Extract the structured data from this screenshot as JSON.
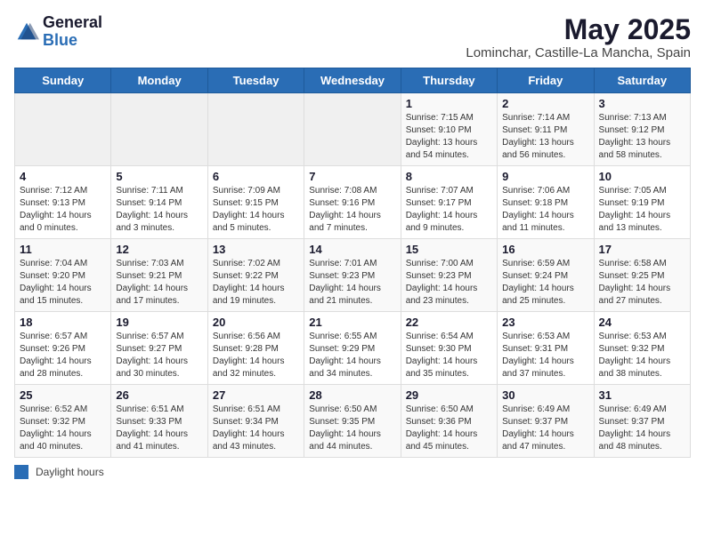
{
  "header": {
    "logo_general": "General",
    "logo_blue": "Blue",
    "month_title": "May 2025",
    "location": "Lominchar, Castille-La Mancha, Spain"
  },
  "weekdays": [
    "Sunday",
    "Monday",
    "Tuesday",
    "Wednesday",
    "Thursday",
    "Friday",
    "Saturday"
  ],
  "weeks": [
    [
      {
        "day": "",
        "info": ""
      },
      {
        "day": "",
        "info": ""
      },
      {
        "day": "",
        "info": ""
      },
      {
        "day": "",
        "info": ""
      },
      {
        "day": "1",
        "info": "Sunrise: 7:15 AM\nSunset: 9:10 PM\nDaylight: 13 hours\nand 54 minutes."
      },
      {
        "day": "2",
        "info": "Sunrise: 7:14 AM\nSunset: 9:11 PM\nDaylight: 13 hours\nand 56 minutes."
      },
      {
        "day": "3",
        "info": "Sunrise: 7:13 AM\nSunset: 9:12 PM\nDaylight: 13 hours\nand 58 minutes."
      }
    ],
    [
      {
        "day": "4",
        "info": "Sunrise: 7:12 AM\nSunset: 9:13 PM\nDaylight: 14 hours\nand 0 minutes."
      },
      {
        "day": "5",
        "info": "Sunrise: 7:11 AM\nSunset: 9:14 PM\nDaylight: 14 hours\nand 3 minutes."
      },
      {
        "day": "6",
        "info": "Sunrise: 7:09 AM\nSunset: 9:15 PM\nDaylight: 14 hours\nand 5 minutes."
      },
      {
        "day": "7",
        "info": "Sunrise: 7:08 AM\nSunset: 9:16 PM\nDaylight: 14 hours\nand 7 minutes."
      },
      {
        "day": "8",
        "info": "Sunrise: 7:07 AM\nSunset: 9:17 PM\nDaylight: 14 hours\nand 9 minutes."
      },
      {
        "day": "9",
        "info": "Sunrise: 7:06 AM\nSunset: 9:18 PM\nDaylight: 14 hours\nand 11 minutes."
      },
      {
        "day": "10",
        "info": "Sunrise: 7:05 AM\nSunset: 9:19 PM\nDaylight: 14 hours\nand 13 minutes."
      }
    ],
    [
      {
        "day": "11",
        "info": "Sunrise: 7:04 AM\nSunset: 9:20 PM\nDaylight: 14 hours\nand 15 minutes."
      },
      {
        "day": "12",
        "info": "Sunrise: 7:03 AM\nSunset: 9:21 PM\nDaylight: 14 hours\nand 17 minutes."
      },
      {
        "day": "13",
        "info": "Sunrise: 7:02 AM\nSunset: 9:22 PM\nDaylight: 14 hours\nand 19 minutes."
      },
      {
        "day": "14",
        "info": "Sunrise: 7:01 AM\nSunset: 9:23 PM\nDaylight: 14 hours\nand 21 minutes."
      },
      {
        "day": "15",
        "info": "Sunrise: 7:00 AM\nSunset: 9:23 PM\nDaylight: 14 hours\nand 23 minutes."
      },
      {
        "day": "16",
        "info": "Sunrise: 6:59 AM\nSunset: 9:24 PM\nDaylight: 14 hours\nand 25 minutes."
      },
      {
        "day": "17",
        "info": "Sunrise: 6:58 AM\nSunset: 9:25 PM\nDaylight: 14 hours\nand 27 minutes."
      }
    ],
    [
      {
        "day": "18",
        "info": "Sunrise: 6:57 AM\nSunset: 9:26 PM\nDaylight: 14 hours\nand 28 minutes."
      },
      {
        "day": "19",
        "info": "Sunrise: 6:57 AM\nSunset: 9:27 PM\nDaylight: 14 hours\nand 30 minutes."
      },
      {
        "day": "20",
        "info": "Sunrise: 6:56 AM\nSunset: 9:28 PM\nDaylight: 14 hours\nand 32 minutes."
      },
      {
        "day": "21",
        "info": "Sunrise: 6:55 AM\nSunset: 9:29 PM\nDaylight: 14 hours\nand 34 minutes."
      },
      {
        "day": "22",
        "info": "Sunrise: 6:54 AM\nSunset: 9:30 PM\nDaylight: 14 hours\nand 35 minutes."
      },
      {
        "day": "23",
        "info": "Sunrise: 6:53 AM\nSunset: 9:31 PM\nDaylight: 14 hours\nand 37 minutes."
      },
      {
        "day": "24",
        "info": "Sunrise: 6:53 AM\nSunset: 9:32 PM\nDaylight: 14 hours\nand 38 minutes."
      }
    ],
    [
      {
        "day": "25",
        "info": "Sunrise: 6:52 AM\nSunset: 9:32 PM\nDaylight: 14 hours\nand 40 minutes."
      },
      {
        "day": "26",
        "info": "Sunrise: 6:51 AM\nSunset: 9:33 PM\nDaylight: 14 hours\nand 41 minutes."
      },
      {
        "day": "27",
        "info": "Sunrise: 6:51 AM\nSunset: 9:34 PM\nDaylight: 14 hours\nand 43 minutes."
      },
      {
        "day": "28",
        "info": "Sunrise: 6:50 AM\nSunset: 9:35 PM\nDaylight: 14 hours\nand 44 minutes."
      },
      {
        "day": "29",
        "info": "Sunrise: 6:50 AM\nSunset: 9:36 PM\nDaylight: 14 hours\nand 45 minutes."
      },
      {
        "day": "30",
        "info": "Sunrise: 6:49 AM\nSunset: 9:37 PM\nDaylight: 14 hours\nand 47 minutes."
      },
      {
        "day": "31",
        "info": "Sunrise: 6:49 AM\nSunset: 9:37 PM\nDaylight: 14 hours\nand 48 minutes."
      }
    ]
  ],
  "legend": {
    "label": "Daylight hours"
  }
}
